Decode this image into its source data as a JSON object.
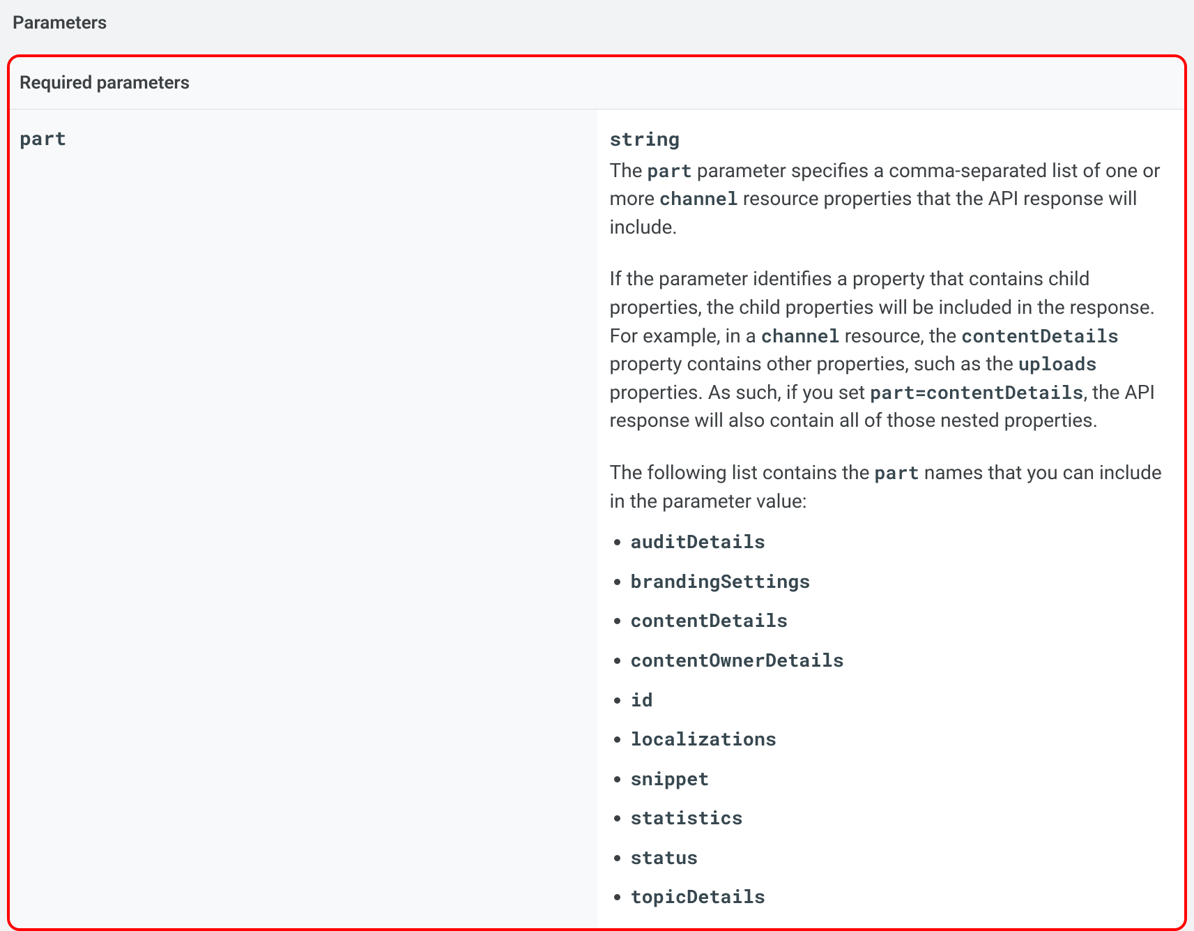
{
  "header": {
    "title": "Parameters"
  },
  "table": {
    "section_header": "Required parameters",
    "row": {
      "name": "part",
      "type": "string",
      "desc": {
        "p1_a": "The ",
        "p1_code1": "part",
        "p1_b": " parameter specifies a comma-separated list of one or more ",
        "p1_code2": "channel",
        "p1_c": " resource properties that the API response will include.",
        "p2_a": "If the parameter identifies a property that contains child properties, the child properties will be included in the response. For example, in a ",
        "p2_code1": "channel",
        "p2_b": " resource, the ",
        "p2_code2": "contentDetails",
        "p2_c": " property contains other properties, such as the ",
        "p2_code3": "uploads",
        "p2_d": " properties. As such, if you set ",
        "p2_code4": "part=contentDetails",
        "p2_e": ", the API response will also contain all of those nested properties.",
        "p3_a": "The following list contains the ",
        "p3_code1": "part",
        "p3_b": " names that you can include in the parameter value:"
      },
      "parts": [
        "auditDetails",
        "brandingSettings",
        "contentDetails",
        "contentOwnerDetails",
        "id",
        "localizations",
        "snippet",
        "statistics",
        "status",
        "topicDetails"
      ]
    }
  }
}
